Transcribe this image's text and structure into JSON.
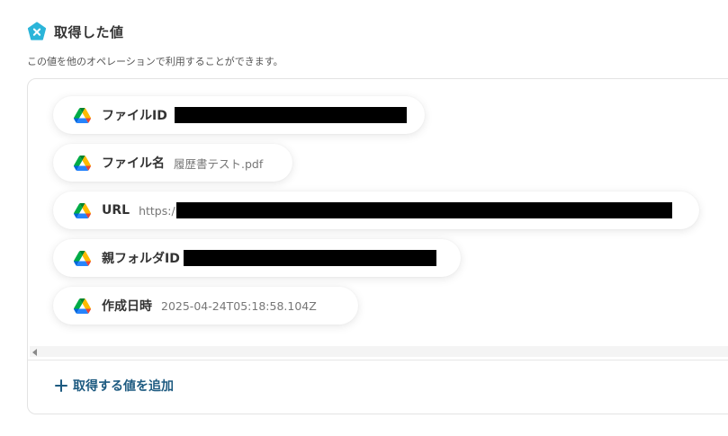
{
  "header": {
    "title": "取得した値",
    "logo_icon": "yoom-x-icon",
    "logo_color": "#2bb5d9"
  },
  "subtitle": "この値を他のオペレーションで利用することができます。",
  "fields": [
    {
      "label": "ファイルID",
      "value": "",
      "redacted": true,
      "icon": "google-drive-icon"
    },
    {
      "label": "ファイル名",
      "value": "履歴書テスト.pdf",
      "redacted": false,
      "icon": "google-drive-icon"
    },
    {
      "label": "URL",
      "value": "https:/",
      "redacted": true,
      "icon": "google-drive-icon"
    },
    {
      "label": "親フォルダID",
      "value": "",
      "redacted": true,
      "icon": "google-drive-icon"
    },
    {
      "label": "作成日時",
      "value": "2025-04-24T05:18:58.104Z",
      "redacted": false,
      "icon": "google-drive-icon"
    }
  ],
  "add_button": {
    "label": "取得する値を追加",
    "icon": "plus-icon",
    "color": "#1d5a80"
  }
}
